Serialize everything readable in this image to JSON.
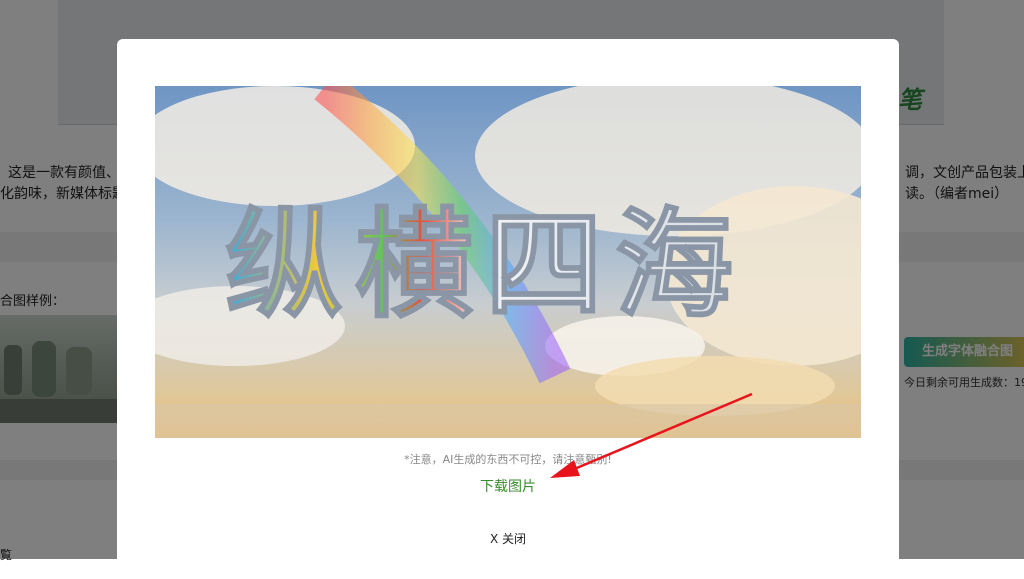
{
  "page": {
    "description_left_1": "这是一款有颜值、",
    "description_left_2": "化韵味，新媒体标题",
    "description_right_1": "调，文创产品包装上",
    "description_right_2": "读。（编者mei）",
    "sample_heading": "合图样例：",
    "generate_button": "生成字体融合图",
    "remaining_text": "今日剩余可用生成数：19",
    "bottom_text": "覧"
  },
  "modal": {
    "image_text": "纵横四海",
    "note": "*注意，AI生成的东西不可控，请注意甄别!",
    "download_label": "下载图片",
    "close_label": "X 关闭"
  },
  "colors": {
    "overlay": "rgba(0,0,0,0.5)",
    "download_link": "#3a8d2f",
    "arrow": "#e8141c",
    "button_gradient_start": "#2bb3a3",
    "button_gradient_end": "#f4c646"
  },
  "icons": {
    "annotation": "red-arrow-icon"
  }
}
